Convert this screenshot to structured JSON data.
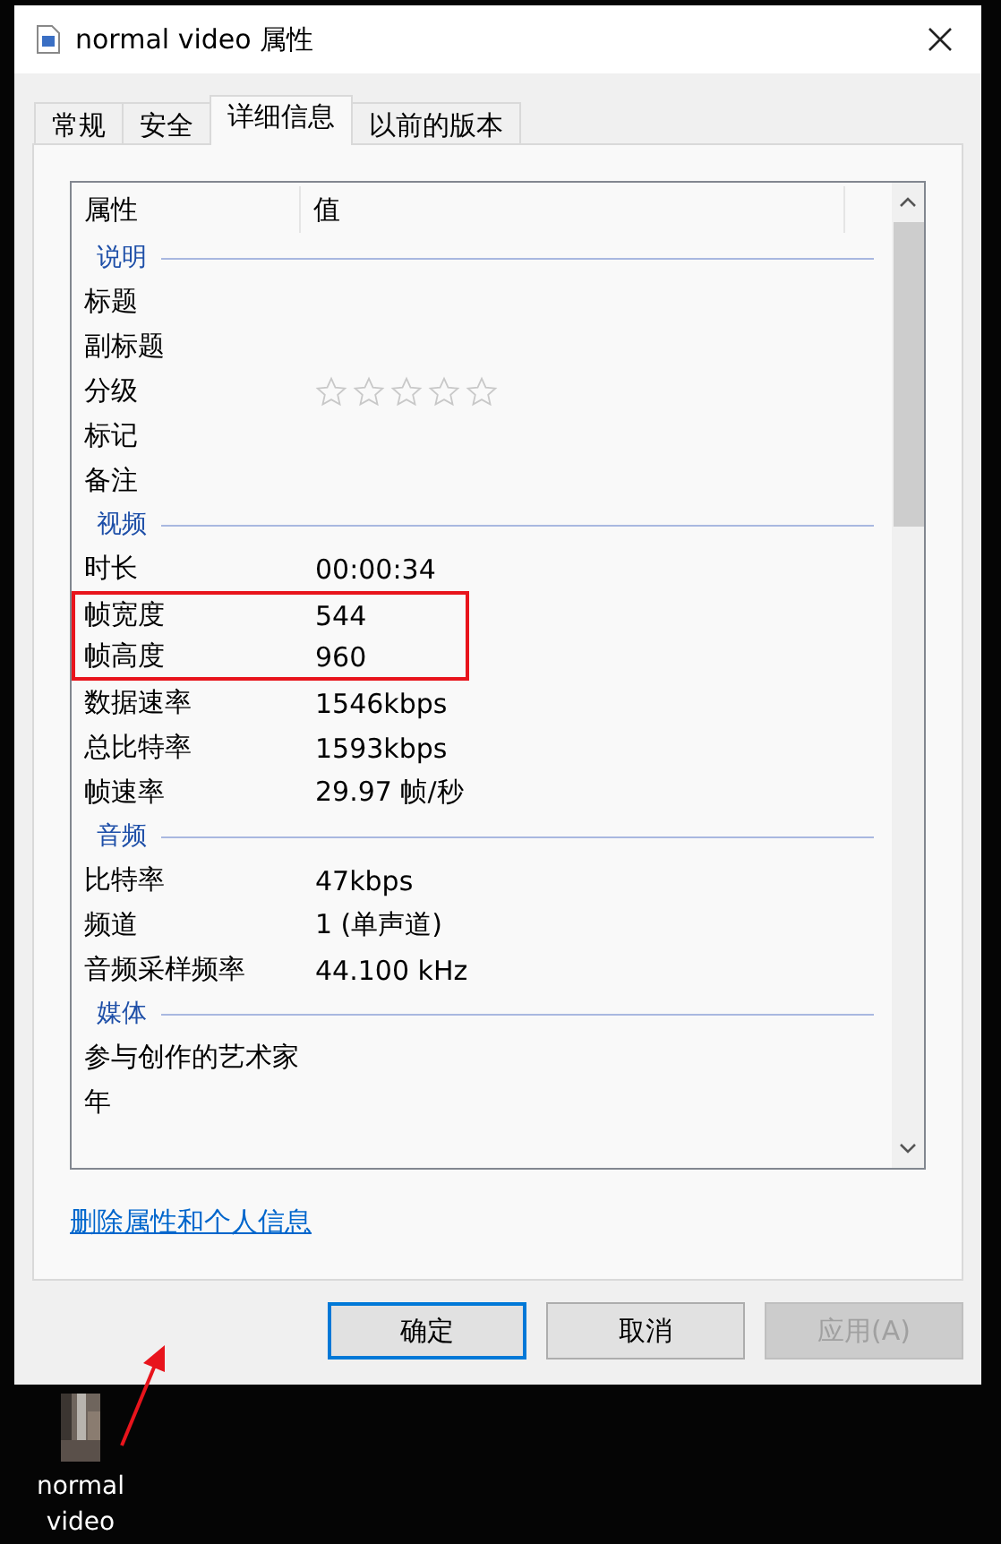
{
  "window": {
    "title": "normal video 属性"
  },
  "tabs": [
    {
      "label": "常规",
      "selected": false
    },
    {
      "label": "安全",
      "selected": false
    },
    {
      "label": "详细信息",
      "selected": true
    },
    {
      "label": "以前的版本",
      "selected": false
    }
  ],
  "table": {
    "columns": [
      "属性",
      "值"
    ],
    "sections": [
      {
        "heading": "说明",
        "rows": [
          {
            "name": "标题",
            "highlighted": false
          },
          {
            "name": "副标题",
            "highlighted": false
          },
          {
            "name": "分级",
            "stars": 0,
            "highlighted": false
          },
          {
            "name": "标记",
            "highlighted": false
          },
          {
            "name": "备注",
            "highlighted": false
          }
        ]
      },
      {
        "heading": "视频",
        "rows": [
          {
            "name": "时长",
            "value": "00:00:34",
            "highlighted": false
          },
          {
            "name": "帧宽度",
            "value": "544",
            "highlighted": true
          },
          {
            "name": "帧高度",
            "value": "960",
            "highlighted": true
          },
          {
            "name": "数据速率",
            "value": "1546kbps",
            "highlighted": false
          },
          {
            "name": "总比特率",
            "value": "1593kbps",
            "highlighted": false
          },
          {
            "name": "帧速率",
            "value": "29.97 帧/秒",
            "highlighted": false
          }
        ]
      },
      {
        "heading": "音频",
        "rows": [
          {
            "name": "比特率",
            "value": "47kbps",
            "highlighted": false
          },
          {
            "name": "频道",
            "value": "1 (单声道)",
            "highlighted": false
          },
          {
            "name": "音频采样频率",
            "value": "44.100 kHz",
            "highlighted": false
          }
        ]
      },
      {
        "heading": "媒体",
        "rows": [
          {
            "name": "参与创作的艺术家",
            "highlighted": false
          },
          {
            "name": "年",
            "highlighted": false
          }
        ]
      }
    ]
  },
  "link": "删除属性和个人信息",
  "buttons": [
    {
      "label": "确定",
      "kind": "default",
      "disabled": false
    },
    {
      "label": "取消",
      "kind": "normal",
      "disabled": false
    },
    {
      "label": "应用(A)",
      "kind": "normal",
      "disabled": true
    }
  ],
  "desktop_icon": {
    "label": "normal video"
  },
  "annotations": [
    {
      "kind": "arrow"
    }
  ]
}
